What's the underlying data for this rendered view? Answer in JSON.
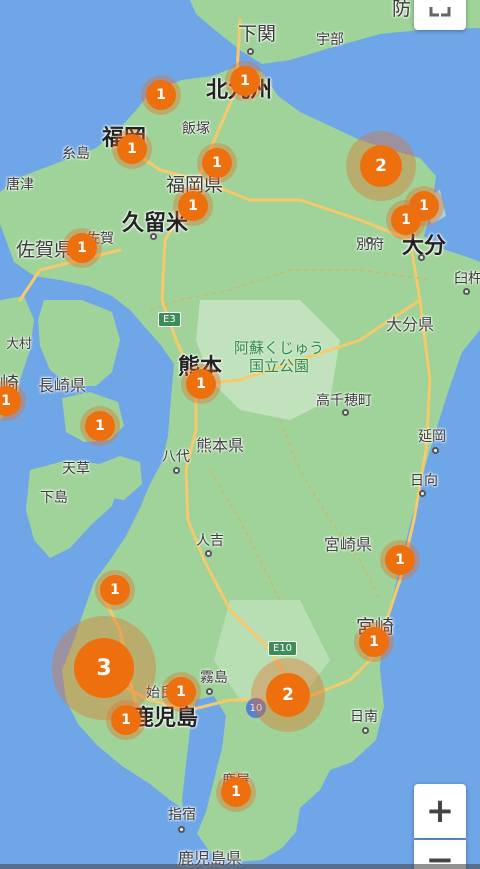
{
  "map": {
    "colors": {
      "sea": "#6fa6e8",
      "land": "#9fd39a",
      "park": "#c9e6c4",
      "cluster": "#ee6f0d",
      "road": "#f6c96a"
    },
    "labels": {
      "shimonoseki": "下関",
      "kitakyushu": "北九州",
      "ube": "宇部",
      "houfu": "防",
      "iizuka": "飯塚",
      "fukuoka_city": "福岡",
      "itoshima": "糸島",
      "fukuoka_pref": "福岡県",
      "karatsu": "唐津",
      "kurume": "久留米",
      "saga_pref": "佐賀県",
      "saga_city": "佐賀",
      "beppu": "別府",
      "oita": "大分",
      "usuki": "臼杵",
      "oita_pref": "大分県",
      "omura": "大村",
      "nagasaki_pref": "長崎県",
      "nagasaki_edge": "崎",
      "aso_park": "阿蘇くじゅう\n国立公園",
      "kumamoto_city": "熊本",
      "takachiho": "高千穂町",
      "nobeoka": "延岡",
      "kumamoto_pref": "熊本県",
      "yatsushiro": "八代",
      "amakusa": "天草",
      "shimoshima": "下島",
      "hyuga": "日向",
      "hitoyoshi": "人吉",
      "miyazaki_pref": "宮崎県",
      "miyazaki_city": "宮崎",
      "kirishima": "霧島",
      "aira": "始良",
      "kagoshima_city": "鹿児島",
      "nichinan": "日南",
      "kanoya": "鹿屋",
      "ibusuki": "指宿",
      "kagoshima_pref": "鹿児島県"
    },
    "shields": {
      "e3": "E3",
      "e10": "E10",
      "r10": "10"
    },
    "clusters": [
      {
        "id": "kitakyushu",
        "count": "1"
      },
      {
        "id": "munakata",
        "count": "1"
      },
      {
        "id": "fukuoka",
        "count": "1"
      },
      {
        "id": "iizuka",
        "count": "1"
      },
      {
        "id": "chikugo",
        "count": "1"
      },
      {
        "id": "nakatsu",
        "count": "2"
      },
      {
        "id": "kunisaki",
        "count": "1"
      },
      {
        "id": "beppu",
        "count": "1"
      },
      {
        "id": "saga",
        "count": "1"
      },
      {
        "id": "nagasaki",
        "count": "1"
      },
      {
        "id": "shimabara",
        "count": "1"
      },
      {
        "id": "kumamoto",
        "count": "1"
      },
      {
        "id": "hyuga",
        "count": "1"
      },
      {
        "id": "miyazaki",
        "count": "1"
      },
      {
        "id": "satsumasendai",
        "count": "1"
      },
      {
        "id": "ichikikushikino",
        "count": "3"
      },
      {
        "id": "aira",
        "count": "1"
      },
      {
        "id": "kagoshima",
        "count": "1"
      },
      {
        "id": "miyakonojo",
        "count": "2"
      },
      {
        "id": "kanoya",
        "count": "1"
      }
    ],
    "controls": {
      "zoom_in": "+",
      "zoom_out": "−"
    }
  }
}
